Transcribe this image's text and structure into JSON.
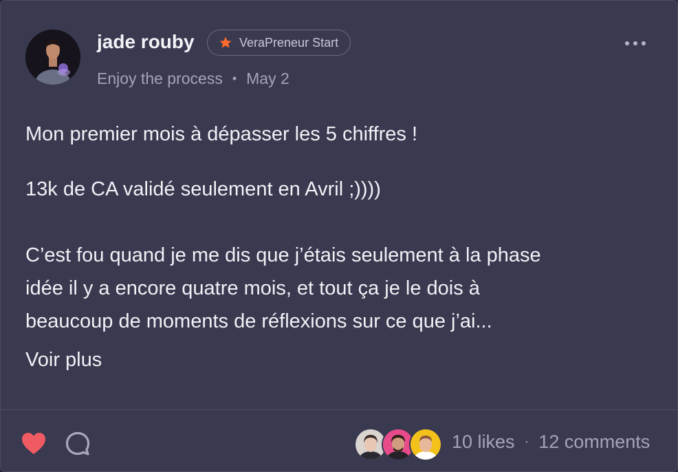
{
  "post": {
    "author": {
      "name": "jade rouby",
      "badge": "VeraPreneur Start",
      "status": "Enjoy the process"
    },
    "date": "May 2",
    "separator": "•",
    "paragraphs": [
      "Mon premier mois à dépasser les 5 chiffres !",
      "13k de CA validé seulement en Avril ;))))",
      "C’est fou quand je me dis que j’étais seulement à la phase\nidée il y a encore quatre mois, et tout ça je le dois à\nbeaucoup de moments de réflexions sur ce que j’ai..."
    ],
    "see_more": "Voir plus"
  },
  "footer": {
    "likes": "10 likes",
    "separator": "·",
    "comments": "12 comments"
  },
  "icons": {
    "badge": "star-icon",
    "like": "heart-icon",
    "comment": "comment-bubble-icon",
    "menu": "more-dots-icon"
  },
  "colors": {
    "card_background": "#393950",
    "like_red": "#f05a63",
    "badge_star": "#ff6b2c",
    "text_primary": "#f1f1f6",
    "text_secondary": "#a4a4b8"
  }
}
